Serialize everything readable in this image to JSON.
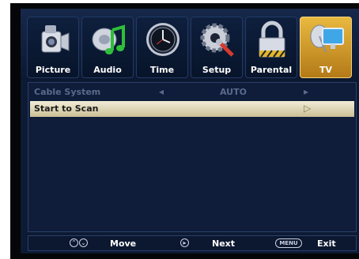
{
  "tabs": [
    {
      "label": "Picture",
      "icon": "camera-icon"
    },
    {
      "label": "Audio",
      "icon": "music-note-icon"
    },
    {
      "label": "Time",
      "icon": "clock-icon"
    },
    {
      "label": "Setup",
      "icon": "gear-wrench-icon"
    },
    {
      "label": "Parental",
      "icon": "padlock-icon"
    },
    {
      "label": "TV",
      "icon": "tv-satellite-icon",
      "active": true
    }
  ],
  "menu": {
    "cable_system": {
      "label": "Cable System",
      "value": "AUTO",
      "left_arrow": "◂",
      "right_arrow": "▸"
    },
    "start_scan": {
      "label": "Start to Scan",
      "arrow": "▷"
    }
  },
  "hint_bar": {
    "move_label": "Move",
    "move_glyph_up": "⌃",
    "move_glyph_down": "⌄",
    "next_label": "Next",
    "next_glyph": "▸",
    "menu_key": "MENU",
    "exit_label": "Exit"
  },
  "colors": {
    "accent_active_tab": "#e8b940",
    "selected_row": "#e6dfc4",
    "background": "#0d1a33"
  }
}
